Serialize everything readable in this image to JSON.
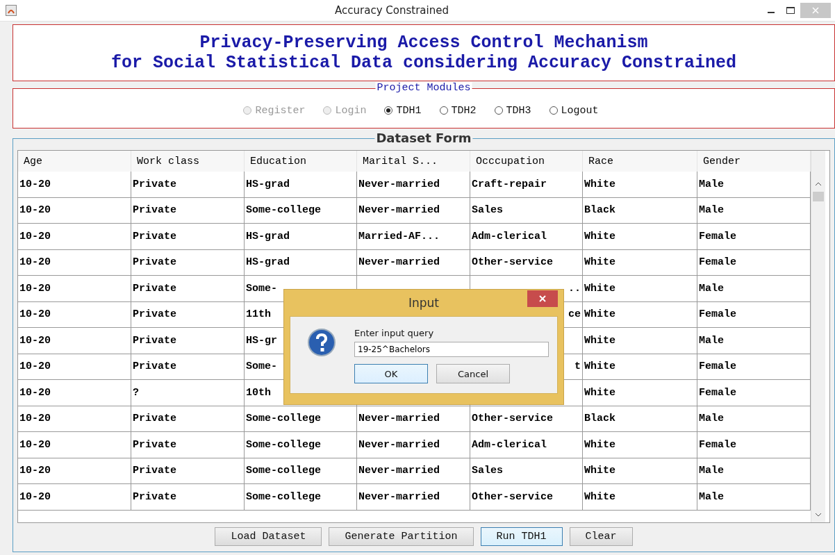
{
  "window": {
    "title": "Accuracy Constrained"
  },
  "header": {
    "lines": [
      "Privacy-Preserving Access Control Mechanism",
      "for Social Statistical Data considering Accuracy Constrained"
    ]
  },
  "modules": {
    "legend": "Project Modules",
    "options": [
      {
        "label": "Register",
        "selected": false,
        "disabled": true
      },
      {
        "label": "Login",
        "selected": false,
        "disabled": true
      },
      {
        "label": "TDH1",
        "selected": true,
        "disabled": false
      },
      {
        "label": "TDH2",
        "selected": false,
        "disabled": false
      },
      {
        "label": "TDH3",
        "selected": false,
        "disabled": false
      },
      {
        "label": "Logout",
        "selected": false,
        "disabled": false
      }
    ]
  },
  "dataset": {
    "legend": "Dataset Form",
    "table": {
      "columns": [
        "Age",
        "Work class",
        "Education",
        "Marital S...",
        "Occcupation",
        "Race",
        "Gender"
      ],
      "rows": [
        [
          "10-20",
          "Private",
          "HS-grad",
          "Never-married",
          "Craft-repair",
          "White",
          "Male"
        ],
        [
          "10-20",
          "Private",
          "Some-college",
          "Never-married",
          "Sales",
          "Black",
          "Male"
        ],
        [
          "10-20",
          "Private",
          "HS-grad",
          "Married-AF...",
          "Adm-clerical",
          "White",
          "Female"
        ],
        [
          "10-20",
          "Private",
          "HS-grad",
          "Never-married",
          "Other-service",
          "White",
          "Female"
        ],
        [
          "10-20",
          "Private",
          "Some-",
          null,
          {
            "tail": ".."
          },
          "White",
          "Male"
        ],
        [
          "10-20",
          "Private",
          "11th",
          null,
          {
            "tail": "ce"
          },
          "White",
          "Female"
        ],
        [
          "10-20",
          "Private",
          "HS-gr",
          null,
          null,
          "White",
          "Male"
        ],
        [
          "10-20",
          "Private",
          "Some-",
          null,
          {
            "tail": "t"
          },
          "White",
          "Female"
        ],
        [
          "10-20",
          "?",
          "10th",
          null,
          null,
          "White",
          "Female"
        ],
        [
          "10-20",
          "Private",
          "Some-college",
          "Never-married",
          "Other-service",
          "Black",
          "Male"
        ],
        [
          "10-20",
          "Private",
          "Some-college",
          "Never-married",
          "Adm-clerical",
          "White",
          "Female"
        ],
        [
          "10-20",
          "Private",
          "Some-college",
          "Never-married",
          "Sales",
          "White",
          "Male"
        ],
        [
          "10-20",
          "Private",
          "Some-college",
          "Never-married",
          "Other-service",
          "White",
          "Male"
        ]
      ]
    },
    "buttons": [
      {
        "label": "Load Dataset",
        "focused": false
      },
      {
        "label": "Generate Partition",
        "focused": false
      },
      {
        "label": "Run TDH1",
        "focused": true
      },
      {
        "label": "Clear",
        "focused": false
      }
    ]
  },
  "dialog": {
    "title": "Input",
    "message": "Enter input query",
    "value": "19-25^Bachelors",
    "buttons": [
      {
        "label": "OK",
        "focused": true
      },
      {
        "label": "Cancel",
        "focused": false
      }
    ]
  }
}
